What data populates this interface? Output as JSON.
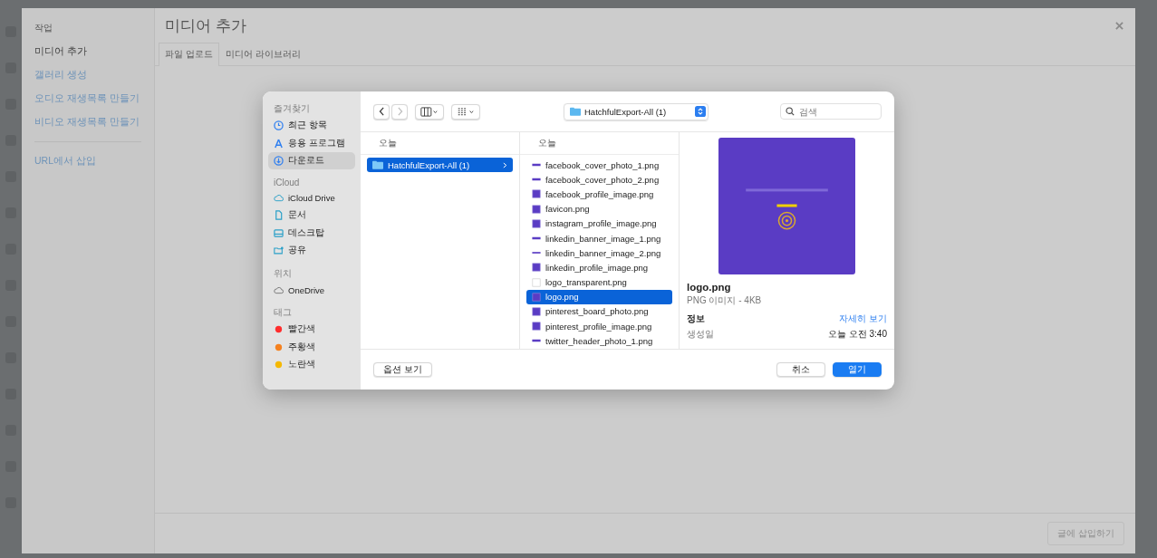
{
  "modal": {
    "title": "미디어 추가",
    "sidebar": {
      "heading": "작업",
      "items": [
        {
          "label": "미디어 추가",
          "selected": true
        },
        {
          "label": "갤러리 생성",
          "selected": false
        },
        {
          "label": "오디오 재생목록 만들기",
          "selected": false
        },
        {
          "label": "비디오 재생목록 만들기",
          "selected": false
        }
      ],
      "extra": "URL에서 삽입"
    },
    "tabs": [
      {
        "label": "파일 업로드",
        "selected": true
      },
      {
        "label": "미디어 라이브러리",
        "selected": false
      }
    ],
    "insert_button": {
      "label": "글에 삽입하기",
      "disabled": true
    }
  },
  "dialog": {
    "sidebar": [
      {
        "heading": "즐겨찾기",
        "items": [
          {
            "label": "최근 항목",
            "selected": false
          },
          {
            "label": "응용 프로그램",
            "selected": false
          },
          {
            "label": "다운로드",
            "selected": true
          }
        ]
      },
      {
        "heading": "iCloud",
        "items": [
          {
            "label": "iCloud Drive",
            "selected": false
          },
          {
            "label": "문서",
            "selected": false
          },
          {
            "label": "데스크탑",
            "selected": false
          },
          {
            "label": "공유",
            "selected": false
          }
        ]
      },
      {
        "heading": "위치",
        "items": [
          {
            "label": "OneDrive",
            "selected": false
          }
        ]
      },
      {
        "heading": "태그",
        "items": [
          {
            "label": "빨간색",
            "color": "#ff2d2d",
            "selected": false
          },
          {
            "label": "주황색",
            "color": "#f5811f",
            "selected": false
          },
          {
            "label": "노란색",
            "color": "#f5b800",
            "selected": false
          }
        ]
      }
    ],
    "location": "HatchfulExport-All (1)",
    "search": {
      "placeholder": "검색"
    },
    "column_1": {
      "heading": "오늘",
      "items": [
        {
          "name": "HatchfulExport-All (1)",
          "selected": true
        }
      ]
    },
    "column_2": {
      "heading": "오늘",
      "items": [
        {
          "name": "facebook_cover_photo_1.png",
          "kind": "banner",
          "selected": false
        },
        {
          "name": "facebook_cover_photo_2.png",
          "kind": "banner",
          "selected": false
        },
        {
          "name": "facebook_profile_image.png",
          "kind": "square",
          "selected": false
        },
        {
          "name": "favicon.png",
          "kind": "square",
          "selected": false
        },
        {
          "name": "instagram_profile_image.png",
          "kind": "square",
          "selected": false
        },
        {
          "name": "linkedin_banner_image_1.png",
          "kind": "banner",
          "selected": false
        },
        {
          "name": "linkedin_banner_image_2.png",
          "kind": "thin",
          "selected": false
        },
        {
          "name": "linkedin_profile_image.png",
          "kind": "square",
          "selected": false
        },
        {
          "name": "logo_transparent.png",
          "kind": "blank",
          "selected": false
        },
        {
          "name": "logo.png",
          "kind": "square",
          "selected": true
        },
        {
          "name": "pinterest_board_photo.png",
          "kind": "square",
          "selected": false
        },
        {
          "name": "pinterest_profile_image.png",
          "kind": "square",
          "selected": false
        },
        {
          "name": "twitter_header_photo_1.png",
          "kind": "banner",
          "selected": false
        }
      ]
    },
    "preview": {
      "name": "logo.png",
      "type": "PNG 이미지 - 4KB",
      "info_heading": "정보",
      "more": "자세히 보기",
      "created_label": "생성일",
      "created_value": "오늘 오전 3:40"
    },
    "options_button": "옵션 보기",
    "cancel_button": "취소",
    "open_button": "열기"
  }
}
